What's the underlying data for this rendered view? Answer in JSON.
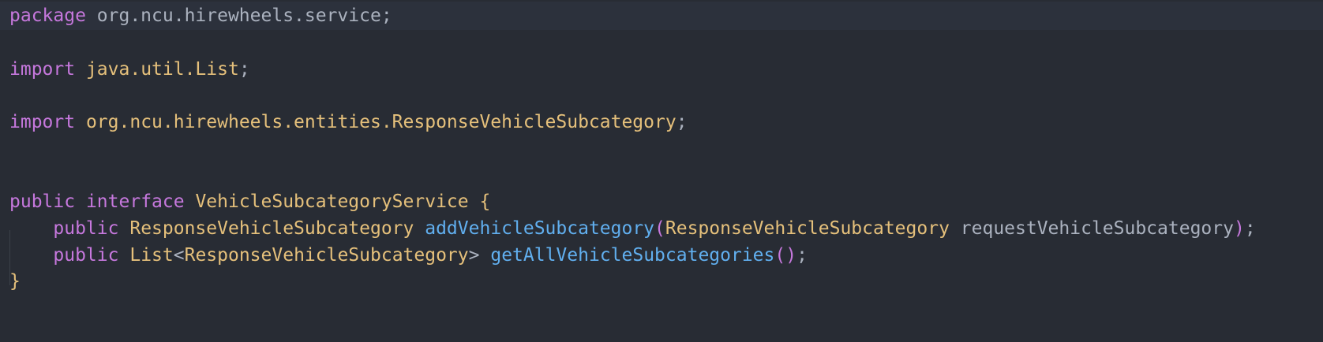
{
  "editor": {
    "theme_colors": {
      "background": "#282c34",
      "keyword": "#c678dd",
      "type": "#e5c07b",
      "function": "#61afef",
      "plain": "#abb2bf"
    },
    "lines": {
      "l1": {
        "kw": "package",
        "pkg": "org.ncu.hirewheels.service",
        "semi": ";"
      },
      "l3": {
        "kw": "import",
        "type": "java.util.List",
        "semi": ";"
      },
      "l5": {
        "kw": "import",
        "type": "org.ncu.hirewheels.entities.ResponseVehicleSubcategory",
        "semi": ";"
      },
      "l8": {
        "kw1": "public",
        "kw2": "interface",
        "type": "VehicleSubcategoryService",
        "brace": "{"
      },
      "l9": {
        "kw": "public",
        "ret": "ResponseVehicleSubcategory",
        "fn": "addVehicleSubcategory",
        "lp": "(",
        "ptype": "ResponseVehicleSubcategory",
        "pname": "requestVehicleSubcategory",
        "rp": ")",
        "semi": ";"
      },
      "l10": {
        "kw": "public",
        "ret_base": "List",
        "lt": "<",
        "ret_arg": "ResponseVehicleSubcategory",
        "gt": ">",
        "fn": "getAllVehicleSubcategories",
        "lp": "(",
        "rp": ")",
        "semi": ";"
      },
      "l11": {
        "brace": "}"
      }
    }
  }
}
